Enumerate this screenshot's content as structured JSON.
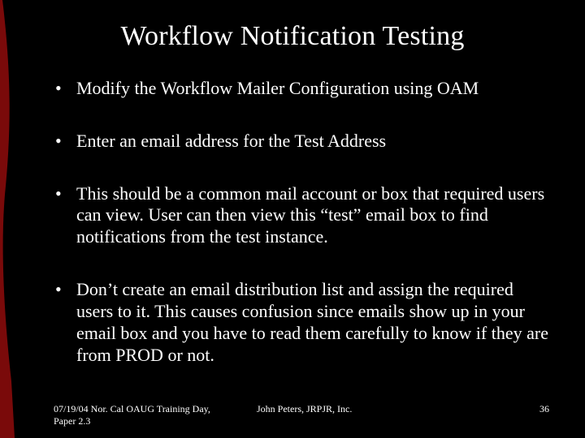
{
  "title": "Workflow Notification Testing",
  "bullets": [
    "Modify the Workflow Mailer Configuration using OAM",
    "Enter an email address for the Test Address",
    "This should be a common mail account or box that required users can view.  User can then view this “test” email box to find notifications from the test instance.",
    "Don’t create an email distribution list and assign the required users to it.  This causes confusion since emails show up in your email box and you have to read them carefully to know if they are from PROD or not."
  ],
  "footer": {
    "left": "07/19/04 Nor. Cal OAUG Training Day, Paper 2.3",
    "center": "John Peters, JRPJR, Inc.",
    "page": "36"
  },
  "accent_color": "#7a0a0a"
}
